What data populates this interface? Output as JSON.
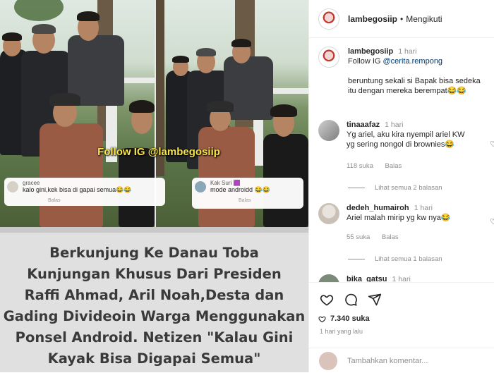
{
  "media": {
    "watermark_left": "Follow IG @lambegosiip",
    "overlay_comment_left": {
      "user": "gracee",
      "text": "kalo gini,kek bisa di gapai semua😂😂",
      "meta": "Balas"
    },
    "overlay_comment_right": {
      "user": "Kak Suri 🟪",
      "text": "mode androidd 😂😂",
      "meta": "Balas"
    },
    "caption_card": "Berkunjung Ke Danau Toba\nKunjungan Khusus Dari Presiden\nRaffi Ahmad, Aril Noah,Desta dan\nGading Divideoin Warga Menggunakan\nPonsel Android. Netizen \"Kalau Gini\nKayak Bisa Digapai Semua\""
  },
  "header": {
    "username": "lambegosiip",
    "separator": "•",
    "follow_status": "Mengikuti"
  },
  "post_caption": {
    "username": "lambegosiip",
    "time": "1 hari",
    "line1_prefix": "Follow IG ",
    "line1_link": "@cerita.rempong",
    "line2": "beruntung sekali si Bapak bisa sedeka",
    "line3": "itu dengan mereka berempat😂😂"
  },
  "comments": [
    {
      "username": "tinaaafaz",
      "time": "1 hari",
      "text1": "Yg ariel, aku kira nyempil ariel KW",
      "text2": "yg sering nongol di brownies😂",
      "likes": "118 suka",
      "reply": "Balas",
      "view_replies": "Lihat semua 2 balasan"
    },
    {
      "username": "dedeh_humairoh",
      "time": "1 hari",
      "text1": "Ariel malah mirip yg kw nya😂",
      "text2": "",
      "likes": "55 suka",
      "reply": "Balas",
      "view_replies": "Lihat semua 1 balasan"
    },
    {
      "username": "bika_gatsu",
      "time": "1 hari",
      "text1": "",
      "text2": "",
      "likes": "",
      "reply": "",
      "view_replies": ""
    }
  ],
  "actions": {
    "likes_count": "7.340 suka",
    "posted": "1 hari yang lalu",
    "add_comment_placeholder": "Tambahkan komentar..."
  },
  "colors": {
    "link": "#00376b",
    "muted": "#8e8e8e",
    "watermark": "#f6e44a"
  }
}
